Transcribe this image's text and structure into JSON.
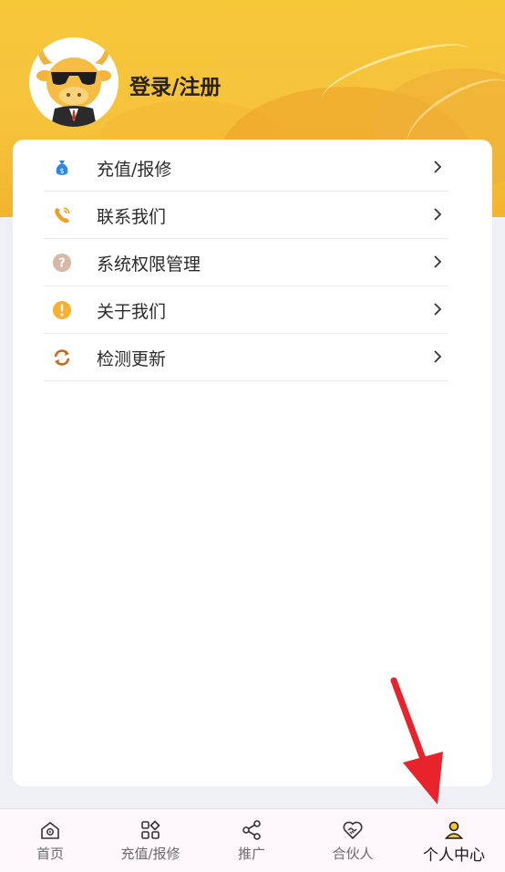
{
  "header": {
    "login_label": "登录/注册",
    "avatar_icon": "cartoon-bull-avatar"
  },
  "menu": {
    "items": [
      {
        "label": "充值/报修",
        "icon": "money-bag-icon"
      },
      {
        "label": "联系我们",
        "icon": "phone-icon"
      },
      {
        "label": "系统权限管理",
        "icon": "question-icon"
      },
      {
        "label": "关于我们",
        "icon": "exclamation-icon"
      },
      {
        "label": "检测更新",
        "icon": "refresh-icon"
      }
    ]
  },
  "tabbar": {
    "tabs": [
      {
        "label": "首页",
        "icon": "home-icon"
      },
      {
        "label": "充值/报修",
        "icon": "grid-icon"
      },
      {
        "label": "推广",
        "icon": "share-icon"
      },
      {
        "label": "合伙人",
        "icon": "handshake-heart-icon"
      },
      {
        "label": "个人中心",
        "icon": "person-icon",
        "active": true
      }
    ]
  },
  "colors": {
    "hero_yellow": "#f6c23a",
    "accent_orange": "#f0a020",
    "arrow_red": "#e8232b"
  }
}
